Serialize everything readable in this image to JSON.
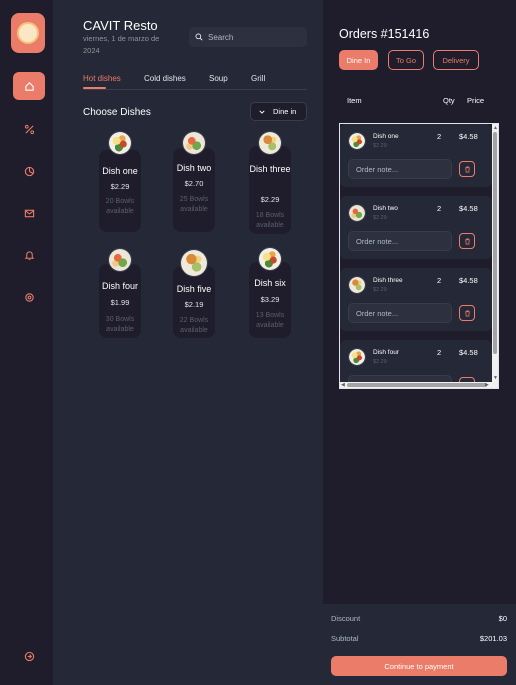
{
  "brand": {
    "name": "CAVIT Resto",
    "date": "viernes, 1 de marzo de 2024"
  },
  "search": {
    "placeholder": "Search"
  },
  "sidebar": {
    "items": [
      "home-icon",
      "discount-icon",
      "dashboard-icon",
      "message-icon",
      "notification-icon",
      "settings-icon"
    ],
    "logout": "logout-icon"
  },
  "tabs": [
    "Hot dishes",
    "Cold dishes",
    "Soup",
    "Grill"
  ],
  "choose": {
    "title": "Choose Dishes",
    "dine_select": "Dine in"
  },
  "dishes": [
    {
      "name": "Dish one",
      "price": "$2.29",
      "avail": "20 Bowls available"
    },
    {
      "name": "Dish two",
      "price": "$2.70",
      "avail": "25 Bowls available"
    },
    {
      "name": "Dish three",
      "price": "$2.29",
      "avail": "18 Bowls available"
    },
    {
      "name": "Dish four",
      "price": "$1.99",
      "avail": "30 Bowls available"
    },
    {
      "name": "Dish five",
      "price": "$2.19",
      "avail": "22 Bowls available"
    },
    {
      "name": "Dish six",
      "price": "$3.29",
      "avail": "13 Bowls available"
    }
  ],
  "orders": {
    "title": "Orders #151416",
    "tabs": [
      "Dine In",
      "To Go",
      "Delivery"
    ],
    "columns": {
      "item": "Item",
      "qty": "Qty",
      "price": "Price"
    },
    "note_placeholder": "Order note...",
    "items": [
      {
        "name": "Dish one",
        "unit": "$2.29",
        "qty": "2",
        "total": "$4.58"
      },
      {
        "name": "Dish two",
        "unit": "$2.29",
        "qty": "2",
        "total": "$4.58"
      },
      {
        "name": "Dish three",
        "unit": "$2.29",
        "qty": "2",
        "total": "$4.58"
      },
      {
        "name": "Dish four",
        "unit": "$2.29",
        "qty": "2",
        "total": "$4.58"
      }
    ],
    "discount_label": "Discount",
    "discount_value": "$0",
    "subtotal_label": "Subtotal",
    "subtotal_value": "$201.03",
    "pay_button": "Continue to payment"
  },
  "colors": {
    "accent": "#ea7c69",
    "bg": "#252836",
    "panel": "#1f1d2b"
  }
}
